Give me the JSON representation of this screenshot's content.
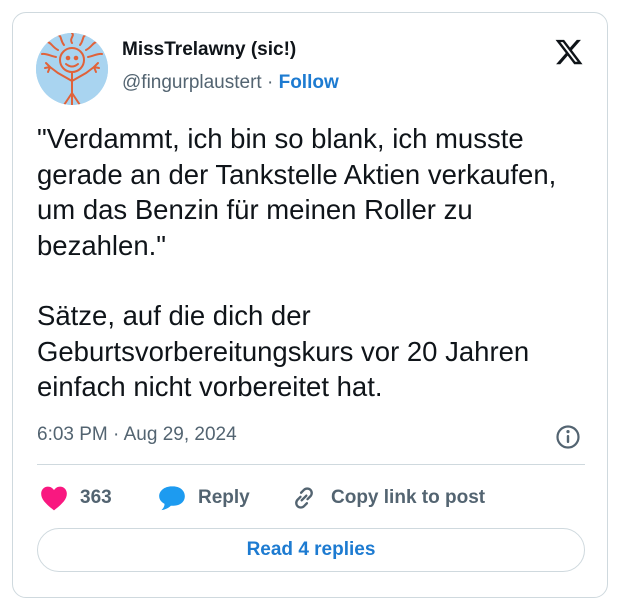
{
  "author": {
    "name": "MissTrelawny (sic!)",
    "handle": "@fingurplaustert",
    "separator": "·",
    "follow_label": "Follow"
  },
  "tweet": {
    "paragraphs": [
      "\"Verdammt, ich bin so blank, ich musste gerade an der Tankstelle Aktien verkaufen, um das Benzin für meinen Roller zu bezahlen.\"",
      "Sätze, auf die dich der Geburtsvorbereitungskurs vor 20 Jahren einfach nicht vorbereitet hat."
    ],
    "time": "6:03 PM",
    "date": "Aug 29, 2024"
  },
  "actions": {
    "likes_count": "363",
    "reply_label": "Reply",
    "copy_label": "Copy link to post"
  },
  "read_replies_label": "Read 4 replies",
  "icons": {
    "x_logo": "x-logo-icon",
    "info": "info-icon",
    "heart": "heart-icon",
    "reply": "speech-bubble-icon",
    "link": "link-icon"
  },
  "colors": {
    "accent": "#1d7bd1",
    "heart": "#f91880",
    "reply_bubble": "#1d9bf0",
    "muted_text": "#536471",
    "border": "#cfd9de"
  }
}
